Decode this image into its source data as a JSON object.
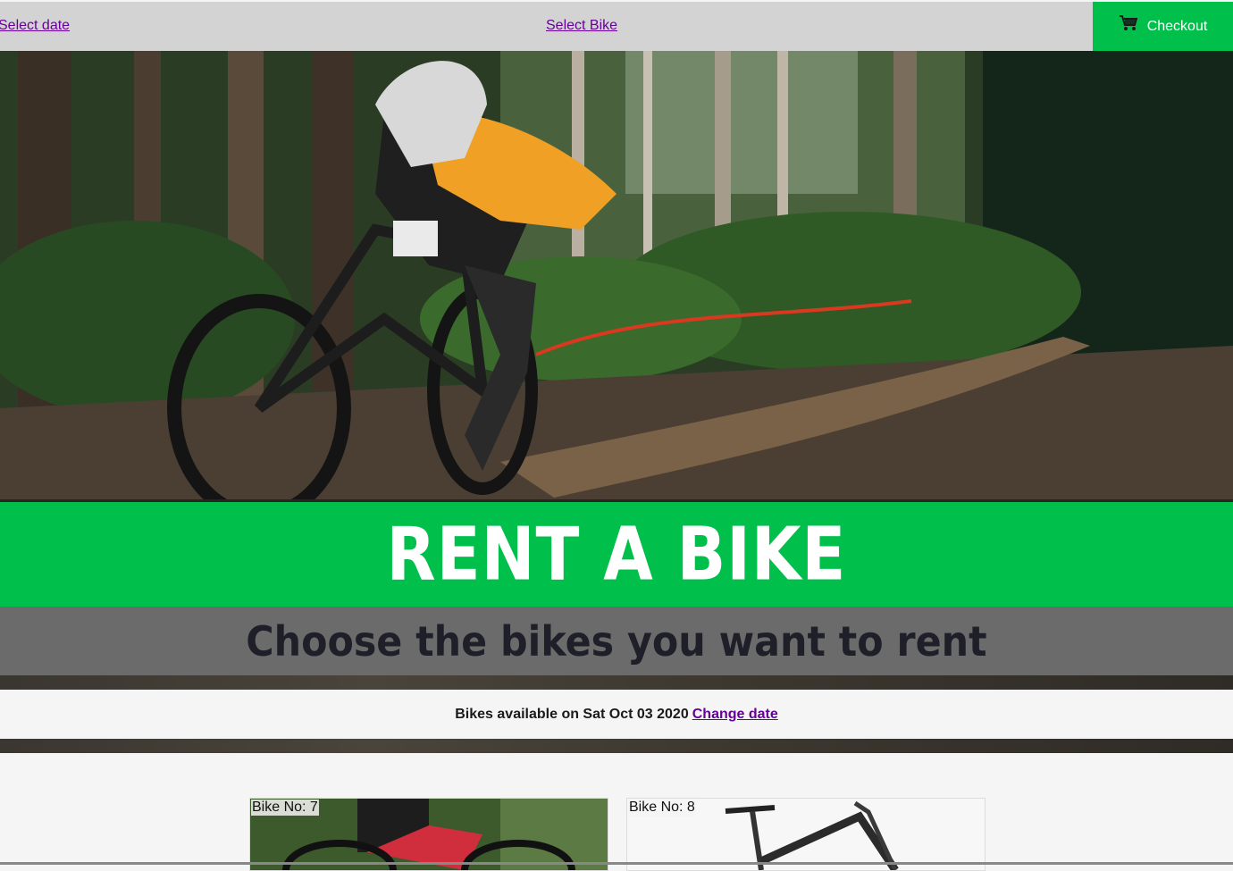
{
  "nav": {
    "select_date": "Select date",
    "select_bike": "Select Bike",
    "checkout": "Checkout",
    "checkout_icon": "cart-icon"
  },
  "hero": {
    "title": "RENT A BIKE",
    "subtitle": "Choose the bikes you want to rent"
  },
  "availability": {
    "text": "Bikes available on Sat Oct 03 2020",
    "change_link": "Change date"
  },
  "bikes": [
    {
      "label": "Bike No: 7"
    },
    {
      "label": "Bike No: 8"
    }
  ],
  "colors": {
    "accent_green": "#00c04b",
    "nav_grey": "#d3d3d3",
    "link_purple": "#660099",
    "subtitle_band": "#6b6b6b"
  }
}
